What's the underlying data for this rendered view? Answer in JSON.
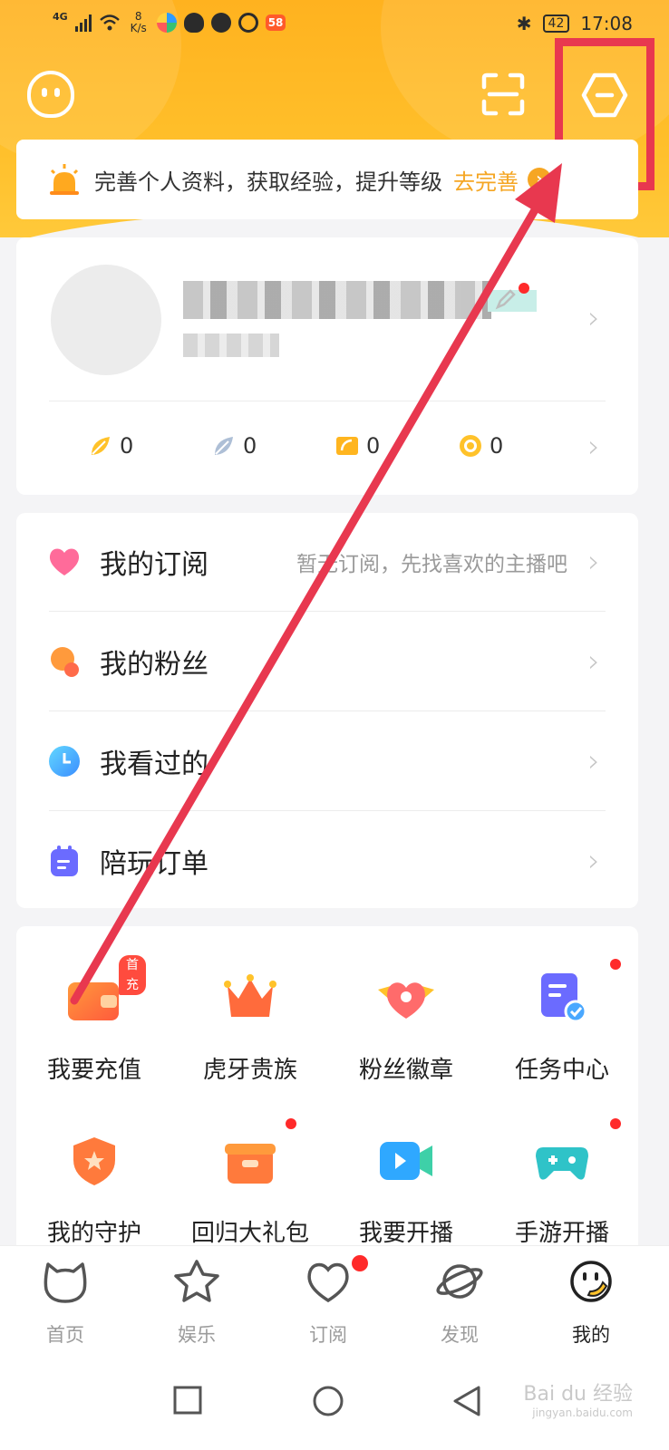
{
  "status_bar": {
    "network": "4G",
    "speed_value": "8",
    "speed_unit": "K/s",
    "app_badge": "58",
    "battery": "42",
    "time": "17:08"
  },
  "banner": {
    "text": "完善个人资料，获取经验，提升等级",
    "link": "去完善",
    "arrow": "›"
  },
  "profile": {
    "stats": [
      {
        "icon": "gold-leaf-icon",
        "value": "0"
      },
      {
        "icon": "silver-leaf-icon",
        "value": "0"
      },
      {
        "icon": "ticket-icon",
        "value": "0"
      },
      {
        "icon": "coin-face-icon",
        "value": "0"
      }
    ]
  },
  "menu": {
    "items": [
      {
        "label": "我的订阅",
        "sub": "暂无订阅，先找喜欢的主播吧",
        "icon": "heart-icon"
      },
      {
        "label": "我的粉丝",
        "sub": "",
        "icon": "fans-icon"
      },
      {
        "label": "我看过的",
        "sub": "",
        "icon": "clock-icon"
      },
      {
        "label": "陪玩订单",
        "sub": "",
        "icon": "order-icon"
      }
    ]
  },
  "grid": {
    "first_badge": "首充",
    "items": [
      {
        "label": "我要充值",
        "icon": "wallet-icon"
      },
      {
        "label": "虎牙贵族",
        "icon": "crown-icon"
      },
      {
        "label": "粉丝徽章",
        "icon": "heart-badge-icon"
      },
      {
        "label": "任务中心",
        "icon": "task-icon"
      },
      {
        "label": "我的守护",
        "icon": "shield-icon"
      },
      {
        "label": "回归大礼包",
        "icon": "gift-icon"
      },
      {
        "label": "我要开播",
        "icon": "video-camera-icon"
      },
      {
        "label": "手游开播",
        "icon": "gamepad-icon"
      }
    ]
  },
  "bottom_nav": {
    "items": [
      {
        "label": "首页",
        "icon": "home-cat-icon"
      },
      {
        "label": "娱乐",
        "icon": "star-icon"
      },
      {
        "label": "订阅",
        "icon": "heart-outline-icon"
      },
      {
        "label": "发现",
        "icon": "planet-icon"
      },
      {
        "label": "我的",
        "icon": "profile-face-icon"
      }
    ]
  },
  "watermark": {
    "brand": "Bai du 经验",
    "site": "jingyan.baidu.com"
  },
  "colors": {
    "accent": "#ffb21f",
    "highlight": "#e8384f",
    "link": "#f5a623"
  }
}
